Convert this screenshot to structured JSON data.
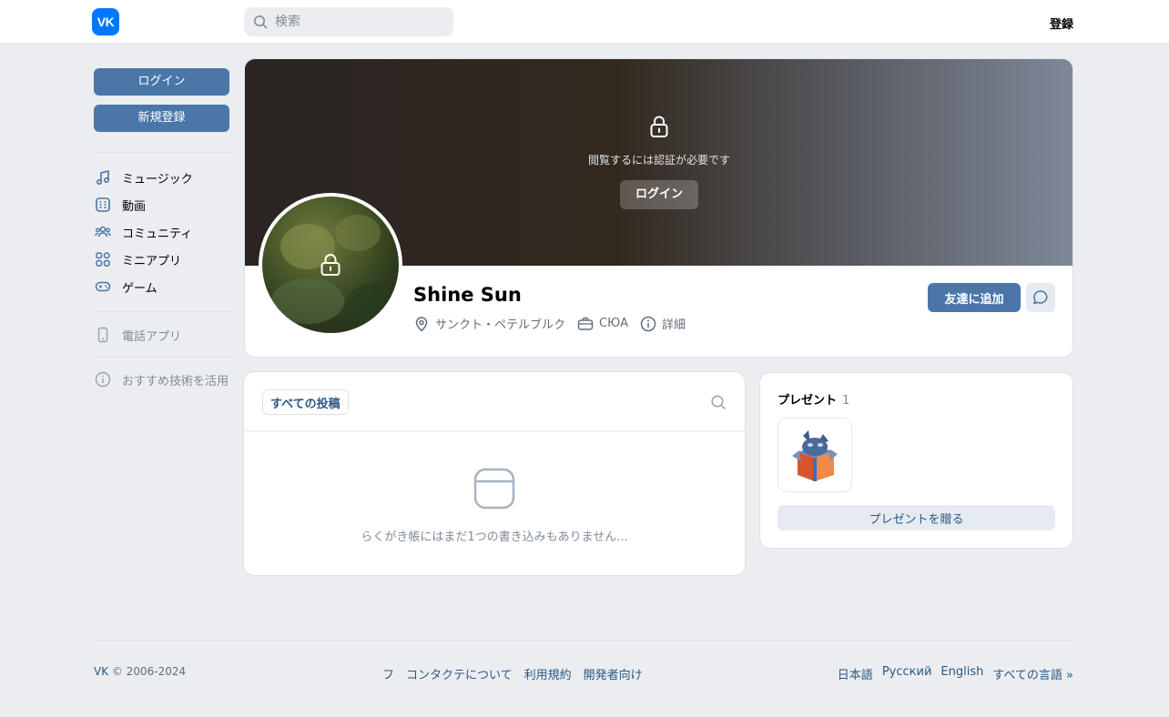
{
  "header": {
    "logo_text": "VK",
    "search_placeholder": "検索",
    "register_label": "登録"
  },
  "sidebar": {
    "login_label": "ログイン",
    "signup_label": "新規登録",
    "items": [
      {
        "label": "ミュージック",
        "icon": "music-icon"
      },
      {
        "label": "動画",
        "icon": "video-icon"
      },
      {
        "label": "コミュニティ",
        "icon": "community-icon"
      },
      {
        "label": "ミニアプリ",
        "icon": "apps-icon"
      },
      {
        "label": "ゲーム",
        "icon": "gamepad-icon"
      }
    ],
    "phone_app_label": "電話アプリ",
    "recommend_label": "おすすめ技術を活用"
  },
  "cover": {
    "auth_text": "閲覧するには認証が必要です",
    "login_label": "ログイン"
  },
  "profile": {
    "name": "Shine Sun",
    "location": "サンクト・ペテルブルク",
    "work": "СЮА",
    "details_label": "詳細",
    "add_friend_label": "友達に追加"
  },
  "wall": {
    "tab_label": "すべての投稿",
    "empty_text": "らくがき帳にはまだ1つの書き込みもありません..."
  },
  "gifts": {
    "title": "プレゼント",
    "count": "1",
    "send_label": "プレゼントを贈る"
  },
  "footer": {
    "vk": "VK",
    "copyright": "© 2006-2024",
    "links": [
      "フ",
      "コンタクテについて",
      "利用規約",
      "開発者向け"
    ],
    "languages": [
      "日本語",
      "Русский",
      "English",
      "すべての言語 »"
    ]
  },
  "colors": {
    "accent": "#4a76a8",
    "link": "#2a5885",
    "logo": "#0077ff",
    "background": "#ebedf0"
  }
}
